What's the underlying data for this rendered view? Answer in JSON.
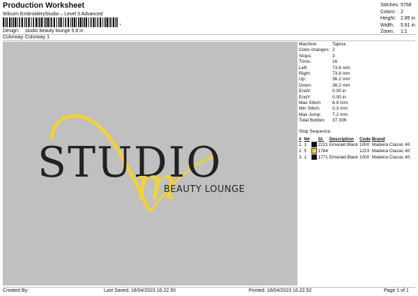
{
  "header": {
    "title": "Production Worksheet",
    "subtitle": "Wilcom EmbroideryStudio – Level 3 Advanced",
    "barcode_suffix": ",",
    "design_label": "Design:",
    "design_value": "studio beauty lounge 5,8 in",
    "colorway_label": "Colorway:",
    "colorway_value": "Colorway 1"
  },
  "stats": [
    {
      "label": "Stitches:",
      "value": "5758"
    },
    {
      "label": "Colors:",
      "value": "2"
    },
    {
      "label": "Height:",
      "value": "2.85 in"
    },
    {
      "label": "Width:",
      "value": "5.81 in"
    },
    {
      "label": "Zoom:",
      "value": "1:1"
    }
  ],
  "details": [
    {
      "label": "Machine:",
      "value": "Tajima"
    },
    {
      "label": "Color changes:",
      "value": "2"
    },
    {
      "label": "Stops:",
      "value": "3"
    },
    {
      "label": "Trims:",
      "value": "16"
    },
    {
      "label": "Left:",
      "value": "73.8 mm"
    },
    {
      "label": "Right:",
      "value": "73.8 mm"
    },
    {
      "label": "Up:",
      "value": "36.2 mm"
    },
    {
      "label": "Down:",
      "value": "36.2 mm"
    },
    {
      "label": "EndX:",
      "value": "0.00 in"
    },
    {
      "label": "EndY:",
      "value": "0.00 in"
    },
    {
      "label": "Max Stitch:",
      "value": "6.9 mm"
    },
    {
      "label": "Min Stitch:",
      "value": "0.3 mm"
    },
    {
      "label": "Max Jump:",
      "value": "7.2 mm"
    },
    {
      "label": "Total Bobbin:",
      "value": "37.33ft"
    }
  ],
  "stop_sequence": {
    "title": "Stop Sequence:",
    "headers": [
      "#",
      "N#",
      "St.",
      "Description",
      "Code",
      "Brand"
    ],
    "rows": [
      {
        "n": "1.",
        "needle": "1",
        "color": "#111111",
        "st": "2221",
        "desc": "Emerald Black",
        "code": "1000",
        "brand": "Madeira Classic 40"
      },
      {
        "n": "2.",
        "needle": "5",
        "color": "#f2d23a",
        "st": "1764",
        "desc": "",
        "code": "1223",
        "brand": "Madeira Classic 40"
      },
      {
        "n": "3.",
        "needle": "1",
        "color": "#111111",
        "st": "1771",
        "desc": "Emerald Black",
        "code": "1000",
        "brand": "Madeira Classic 40"
      }
    ]
  },
  "design": {
    "main_text": "STUDIO",
    "sub_text": "BEAUTY LOUNGE",
    "script_letter": "m",
    "text_color": "#222222",
    "accent_color": "#f2d23a",
    "background_color": "#c0c0c0"
  },
  "footer": {
    "created": "Created By:",
    "saved": "Last Saved: 18/04/2023 16.22.50",
    "printed": "Printed: 18/04/2023 16.22.52",
    "page": "Page 1 of 1"
  }
}
